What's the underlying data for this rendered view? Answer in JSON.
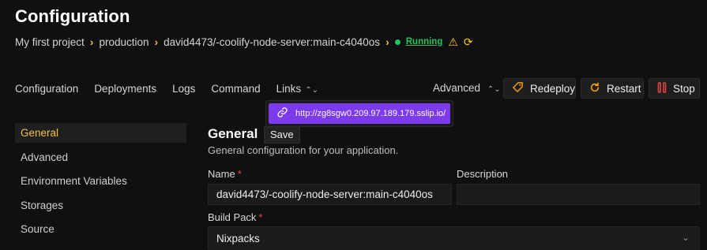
{
  "page": {
    "title": "Configuration"
  },
  "breadcrumb": {
    "project": "My first project",
    "environment": "production",
    "resource": "david4473/-coolify-node-server:main-c4040os",
    "status": "Running"
  },
  "tabs": [
    {
      "label": "Configuration"
    },
    {
      "label": "Deployments"
    },
    {
      "label": "Logs"
    },
    {
      "label": "Command"
    },
    {
      "label": "Links"
    }
  ],
  "actions": {
    "advanced": "Advanced",
    "redeploy": "Redeploy",
    "restart": "Restart",
    "stop": "Stop"
  },
  "links_dropdown": {
    "url": "http://zg8sgw0.209.97.189.179.sslip.io/"
  },
  "sidebar": {
    "items": [
      {
        "label": "General",
        "active": true
      },
      {
        "label": "Advanced"
      },
      {
        "label": "Environment Variables"
      },
      {
        "label": "Storages"
      },
      {
        "label": "Source"
      }
    ]
  },
  "general": {
    "title": "General",
    "save_label": "Save",
    "subtitle": "General configuration for your application.",
    "name_label": "Name",
    "name_value": "david4473/-coolify-node-server:main-c4040os",
    "description_label": "Description",
    "description_value": "",
    "build_pack_label": "Build Pack",
    "build_pack_value": "Nixpacks",
    "required_mark": "*"
  },
  "colors": {
    "accent_yellow": "#f4c13b",
    "status_green": "#22c55e",
    "dropdown_purple": "#7c3aed",
    "danger_red": "#ef4444"
  },
  "icons": [
    "chevron-right-icon",
    "status-dot-icon",
    "warning-icon",
    "sync-icon",
    "chevron-updown-icon",
    "tag-icon",
    "restart-icon",
    "stop-icon",
    "link-icon",
    "chevron-down-icon"
  ]
}
